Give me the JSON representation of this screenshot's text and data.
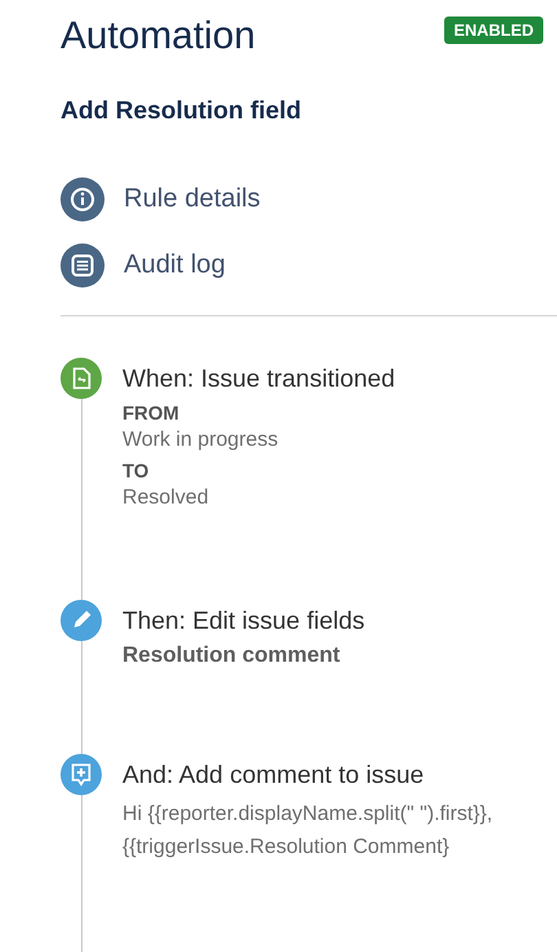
{
  "header": {
    "title": "Automation",
    "status": "ENABLED"
  },
  "rule_name": "Add Resolution field",
  "menu": [
    {
      "kind": "info",
      "label": "Rule details"
    },
    {
      "kind": "list",
      "label": "Audit log"
    }
  ],
  "steps": [
    {
      "kind": "trigger",
      "color": "#5ea646",
      "title": "When: Issue transitioned",
      "details": [
        {
          "kind": "label",
          "text": "FROM"
        },
        {
          "kind": "value",
          "text": "Work in progress"
        },
        {
          "kind": "label",
          "text": "TO"
        },
        {
          "kind": "value",
          "text": "Resolved"
        }
      ]
    },
    {
      "kind": "edit",
      "color": "#4da3dc",
      "title": "Then: Edit issue fields",
      "details": [
        {
          "kind": "field",
          "text": "Resolution comment"
        }
      ]
    },
    {
      "kind": "comment",
      "color": "#4da3dc",
      "title": "And: Add comment to issue",
      "details": [
        {
          "kind": "value",
          "text": "Hi {{reporter.displayName.split(\" \").first}},"
        },
        {
          "kind": "value",
          "text": "{{triggerIssue.Resolution Comment}"
        }
      ]
    }
  ]
}
